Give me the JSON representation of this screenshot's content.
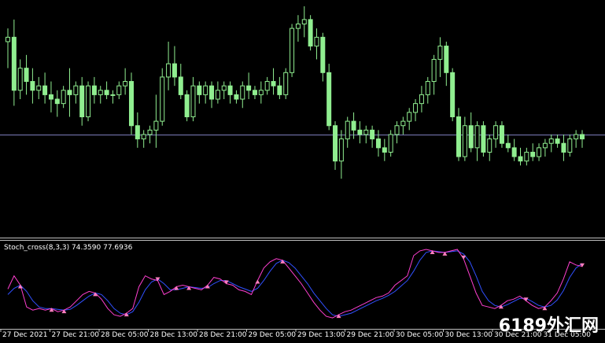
{
  "colors": {
    "background": "#000000",
    "candle": "#90ee90",
    "level_line": "#8080c0",
    "border": "#c0c0c0",
    "stoch_main": "#ff3fd0",
    "stoch_signal": "#3050ff",
    "cross_marker": "#ff7fbf"
  },
  "indicator": {
    "title": "Stoch_cross(8,3,3) 74.3590 77.6936"
  },
  "time_axis": {
    "labels": [
      "27 Dec 2021",
      "27 Dec 21:00",
      "28 Dec 05:00",
      "28 Dec 13:00",
      "28 Dec 21:00",
      "29 Dec 05:00",
      "29 Dec 13:00",
      "29 Dec 21:00",
      "30 Dec 05:00",
      "30 Dec 13:00",
      "30 Dec 21:00",
      "31 Dec 05:00"
    ]
  },
  "watermark": "6189外汇网",
  "chart_data": {
    "type": "candlestick",
    "price_level": 0.43,
    "candles": [
      [
        0.84,
        0.9,
        0.72,
        0.86
      ],
      [
        0.86,
        0.94,
        0.55,
        0.62
      ],
      [
        0.62,
        0.76,
        0.58,
        0.72
      ],
      [
        0.72,
        0.78,
        0.6,
        0.66
      ],
      [
        0.66,
        0.72,
        0.56,
        0.62
      ],
      [
        0.62,
        0.68,
        0.58,
        0.64
      ],
      [
        0.64,
        0.7,
        0.56,
        0.6
      ],
      [
        0.6,
        0.66,
        0.52,
        0.58
      ],
      [
        0.58,
        0.62,
        0.5,
        0.56
      ],
      [
        0.56,
        0.64,
        0.54,
        0.62
      ],
      [
        0.62,
        0.72,
        0.5,
        0.6
      ],
      [
        0.6,
        0.66,
        0.56,
        0.64
      ],
      [
        0.64,
        0.68,
        0.46,
        0.5
      ],
      [
        0.5,
        0.66,
        0.48,
        0.64
      ],
      [
        0.64,
        0.68,
        0.56,
        0.6
      ],
      [
        0.6,
        0.64,
        0.56,
        0.62
      ],
      [
        0.62,
        0.66,
        0.58,
        0.6
      ],
      [
        0.6,
        0.62,
        0.56,
        0.6
      ],
      [
        0.6,
        0.66,
        0.58,
        0.64
      ],
      [
        0.64,
        0.72,
        0.6,
        0.66
      ],
      [
        0.66,
        0.7,
        0.42,
        0.46
      ],
      [
        0.46,
        0.52,
        0.36,
        0.4
      ],
      [
        0.4,
        0.44,
        0.36,
        0.42
      ],
      [
        0.42,
        0.46,
        0.38,
        0.44
      ],
      [
        0.44,
        0.6,
        0.36,
        0.48
      ],
      [
        0.48,
        0.72,
        0.46,
        0.68
      ],
      [
        0.68,
        0.84,
        0.62,
        0.74
      ],
      [
        0.74,
        0.82,
        0.64,
        0.68
      ],
      [
        0.68,
        0.74,
        0.58,
        0.6
      ],
      [
        0.6,
        0.62,
        0.48,
        0.5
      ],
      [
        0.5,
        0.68,
        0.48,
        0.64
      ],
      [
        0.64,
        0.66,
        0.56,
        0.6
      ],
      [
        0.6,
        0.66,
        0.56,
        0.64
      ],
      [
        0.64,
        0.66,
        0.54,
        0.58
      ],
      [
        0.58,
        0.66,
        0.56,
        0.62
      ],
      [
        0.62,
        0.66,
        0.58,
        0.64
      ],
      [
        0.64,
        0.66,
        0.56,
        0.6
      ],
      [
        0.6,
        0.62,
        0.56,
        0.58
      ],
      [
        0.58,
        0.66,
        0.54,
        0.64
      ],
      [
        0.64,
        0.7,
        0.58,
        0.62
      ],
      [
        0.62,
        0.64,
        0.58,
        0.6
      ],
      [
        0.6,
        0.66,
        0.56,
        0.62
      ],
      [
        0.62,
        0.68,
        0.6,
        0.66
      ],
      [
        0.66,
        0.72,
        0.6,
        0.64
      ],
      [
        0.64,
        0.68,
        0.58,
        0.6
      ],
      [
        0.6,
        0.72,
        0.58,
        0.7
      ],
      [
        0.7,
        0.92,
        0.68,
        0.9
      ],
      [
        0.9,
        0.96,
        0.84,
        0.92
      ],
      [
        0.92,
        1.0,
        0.86,
        0.94
      ],
      [
        0.94,
        0.96,
        0.8,
        0.82
      ],
      [
        0.82,
        0.9,
        0.76,
        0.86
      ],
      [
        0.86,
        0.88,
        0.66,
        0.7
      ],
      [
        0.7,
        0.74,
        0.44,
        0.46
      ],
      [
        0.46,
        0.48,
        0.26,
        0.3
      ],
      [
        0.3,
        0.44,
        0.22,
        0.4
      ],
      [
        0.4,
        0.5,
        0.36,
        0.48
      ],
      [
        0.48,
        0.52,
        0.4,
        0.44
      ],
      [
        0.44,
        0.48,
        0.38,
        0.42
      ],
      [
        0.42,
        0.46,
        0.38,
        0.44
      ],
      [
        0.44,
        0.46,
        0.36,
        0.4
      ],
      [
        0.4,
        0.44,
        0.32,
        0.36
      ],
      [
        0.36,
        0.4,
        0.3,
        0.34
      ],
      [
        0.34,
        0.44,
        0.32,
        0.42
      ],
      [
        0.42,
        0.48,
        0.38,
        0.46
      ],
      [
        0.46,
        0.5,
        0.42,
        0.48
      ],
      [
        0.48,
        0.54,
        0.44,
        0.52
      ],
      [
        0.52,
        0.58,
        0.48,
        0.56
      ],
      [
        0.56,
        0.64,
        0.52,
        0.6
      ],
      [
        0.6,
        0.68,
        0.56,
        0.66
      ],
      [
        0.66,
        0.78,
        0.6,
        0.76
      ],
      [
        0.76,
        0.86,
        0.68,
        0.82
      ],
      [
        0.82,
        0.84,
        0.64,
        0.7
      ],
      [
        0.7,
        0.72,
        0.48,
        0.5
      ],
      [
        0.5,
        0.54,
        0.3,
        0.32
      ],
      [
        0.32,
        0.5,
        0.3,
        0.46
      ],
      [
        0.46,
        0.52,
        0.34,
        0.36
      ],
      [
        0.36,
        0.48,
        0.3,
        0.46
      ],
      [
        0.46,
        0.48,
        0.32,
        0.34
      ],
      [
        0.34,
        0.42,
        0.3,
        0.4
      ],
      [
        0.4,
        0.48,
        0.36,
        0.46
      ],
      [
        0.46,
        0.48,
        0.36,
        0.38
      ],
      [
        0.38,
        0.42,
        0.34,
        0.36
      ],
      [
        0.36,
        0.4,
        0.3,
        0.32
      ],
      [
        0.32,
        0.36,
        0.28,
        0.3
      ],
      [
        0.3,
        0.36,
        0.28,
        0.34
      ],
      [
        0.34,
        0.38,
        0.3,
        0.32
      ],
      [
        0.32,
        0.38,
        0.3,
        0.36
      ],
      [
        0.36,
        0.4,
        0.32,
        0.38
      ],
      [
        0.38,
        0.42,
        0.34,
        0.4
      ],
      [
        0.4,
        0.42,
        0.36,
        0.38
      ],
      [
        0.38,
        0.42,
        0.3,
        0.34
      ],
      [
        0.34,
        0.42,
        0.32,
        0.4
      ],
      [
        0.4,
        0.44,
        0.36,
        0.42
      ],
      [
        0.42,
        0.44,
        0.36,
        0.4
      ]
    ],
    "stoch_main": [
      45,
      62,
      50,
      22,
      18,
      20,
      18,
      20,
      16,
      18,
      22,
      30,
      38,
      42,
      40,
      32,
      20,
      12,
      10,
      14,
      20,
      48,
      62,
      58,
      56,
      38,
      42,
      48,
      50,
      48,
      46,
      44,
      50,
      60,
      58,
      52,
      50,
      44,
      42,
      38,
      56,
      72,
      80,
      84,
      82,
      72,
      62,
      52,
      40,
      28,
      18,
      10,
      8,
      12,
      16,
      18,
      22,
      26,
      30,
      34,
      36,
      40,
      50,
      56,
      62,
      88,
      94,
      96,
      94,
      92,
      92,
      94,
      96,
      84,
      62,
      40,
      24,
      22,
      20,
      24,
      30,
      32,
      36,
      30,
      24,
      20,
      22,
      30,
      40,
      58,
      80,
      76,
      74
    ],
    "stoch_signal": [
      38,
      46,
      50,
      42,
      30,
      22,
      20,
      20,
      19,
      18,
      19,
      24,
      30,
      36,
      40,
      38,
      30,
      20,
      14,
      12,
      16,
      28,
      44,
      54,
      58,
      52,
      44,
      44,
      46,
      48,
      47,
      46,
      47,
      52,
      56,
      56,
      52,
      48,
      45,
      42,
      46,
      56,
      68,
      78,
      82,
      79,
      72,
      62,
      52,
      40,
      30,
      20,
      12,
      10,
      12,
      14,
      18,
      22,
      26,
      30,
      33,
      37,
      42,
      49,
      56,
      68,
      82,
      92,
      94,
      93,
      92,
      93,
      94,
      90,
      80,
      62,
      42,
      30,
      24,
      22,
      25,
      29,
      33,
      33,
      29,
      24,
      22,
      24,
      31,
      43,
      60,
      72,
      78
    ]
  }
}
